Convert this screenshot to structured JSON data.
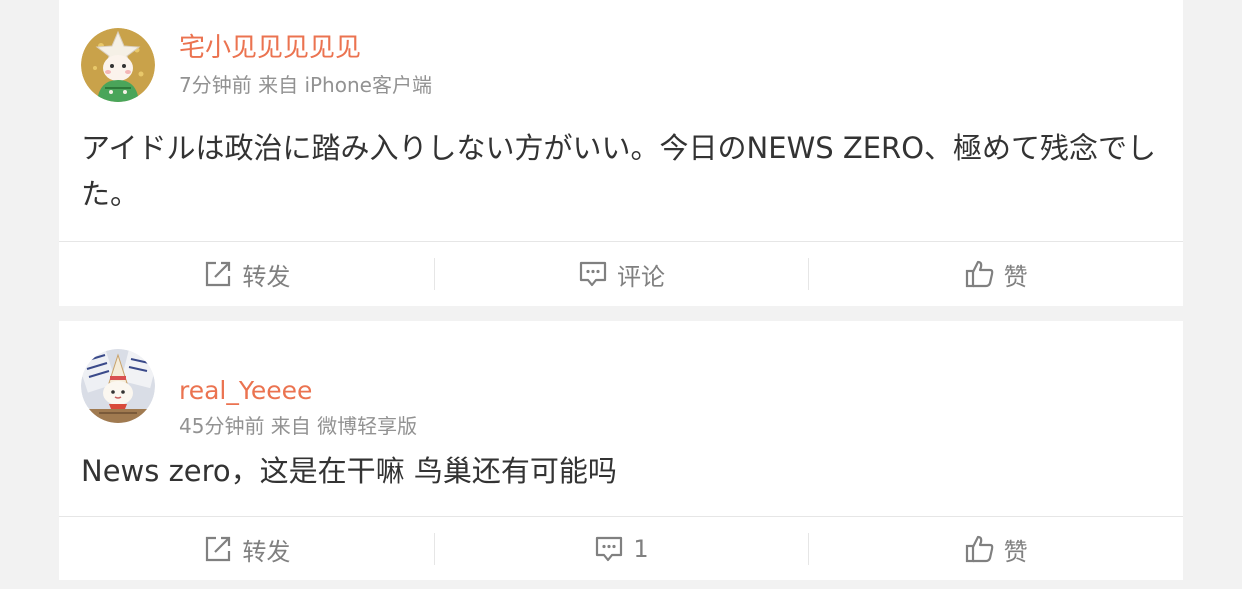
{
  "posts": [
    {
      "username": "宅小见见见见见",
      "meta": "7分钟前 来自 iPhone客户端",
      "text": "アイドルは政治に踏み入りしない方がいい。今日のNEWS ZERO、極めて残念でした。",
      "actions": {
        "repost_label": "转发",
        "comment_label": "评论",
        "like_label": "赞"
      },
      "avatar_icon": "star-hat-character-avatar"
    },
    {
      "username": "real_Yeeee",
      "meta": "45分钟前 来自 微博轻享版",
      "text": "News zero，这是在干嘛 鸟巢还有可能吗",
      "actions": {
        "repost_label": "转发",
        "comment_label": "1",
        "like_label": "赞"
      },
      "avatar_icon": "party-hat-character-avatar"
    }
  ],
  "icons": {
    "repost": "repost-icon",
    "comment": "comment-icon",
    "like": "thumbs-up-icon"
  },
  "colors": {
    "username": "#eb7350",
    "meta": "#929292",
    "text": "#333333",
    "action": "#808080",
    "background": "#f2f2f2",
    "card": "#ffffff",
    "divider": "#e6e6e6"
  }
}
